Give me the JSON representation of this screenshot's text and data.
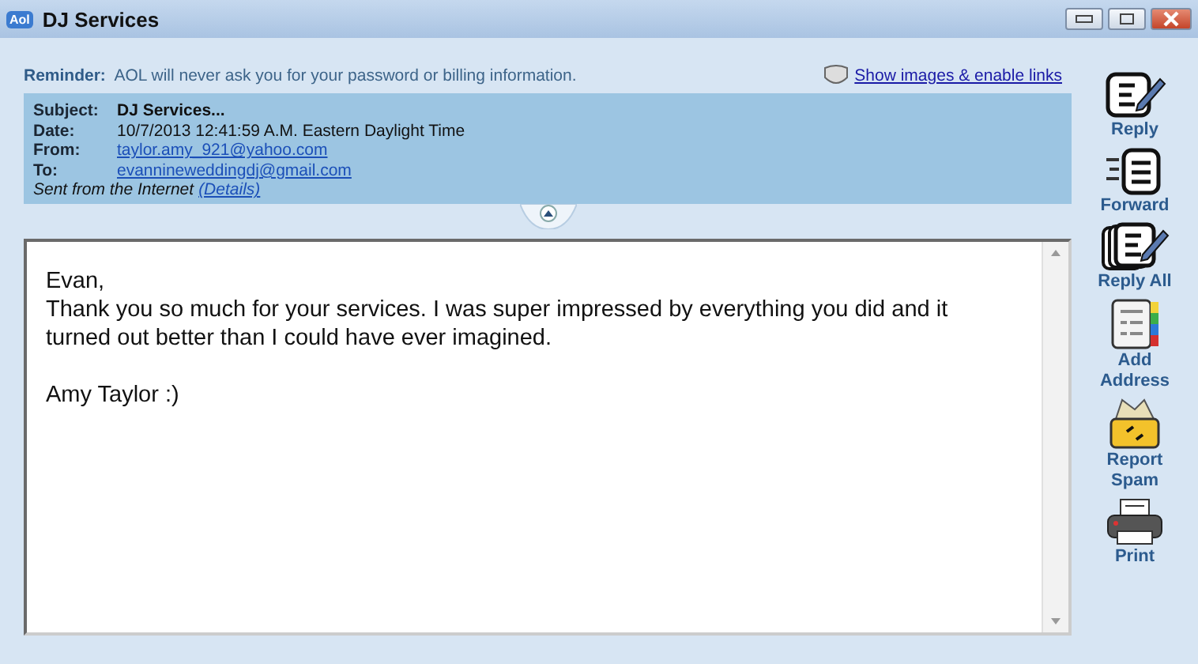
{
  "window": {
    "title": "DJ Services",
    "app_badge": "Aol"
  },
  "reminder": {
    "label": "Reminder:",
    "text": "AOL will never ask you for your password or billing information.",
    "link": "Show images & enable links"
  },
  "headers": [
    {
      "label": "Subject:",
      "value": "DJ Services...",
      "kind": "bold"
    },
    {
      "label": "Date:",
      "value": "10/7/2013 12:41:59 A.M. Eastern Daylight Time",
      "kind": "text"
    },
    {
      "label": "From:",
      "value": "taylor.amy_921@yahoo.com",
      "kind": "link"
    },
    {
      "label": "To:",
      "value": "evannineweddingdj@gmail.com",
      "kind": "link"
    }
  ],
  "sent_from": {
    "text": "Sent from the Internet",
    "link": "(Details)"
  },
  "body": [
    "Evan,",
    "Thank you so much for your services. I was super impressed by everything you did and it turned out better than I could have ever imagined."
  ],
  "signature": "Amy Taylor :)",
  "actions": [
    {
      "label": "Reply",
      "kind": "reply"
    },
    {
      "label": "Forward",
      "kind": "forward"
    },
    {
      "label": "Reply All",
      "kind": "replyall"
    },
    {
      "label": "Add Address",
      "kind": "address"
    },
    {
      "label": "Report Spam",
      "kind": "spam"
    },
    {
      "label": "Print",
      "kind": "print"
    }
  ]
}
